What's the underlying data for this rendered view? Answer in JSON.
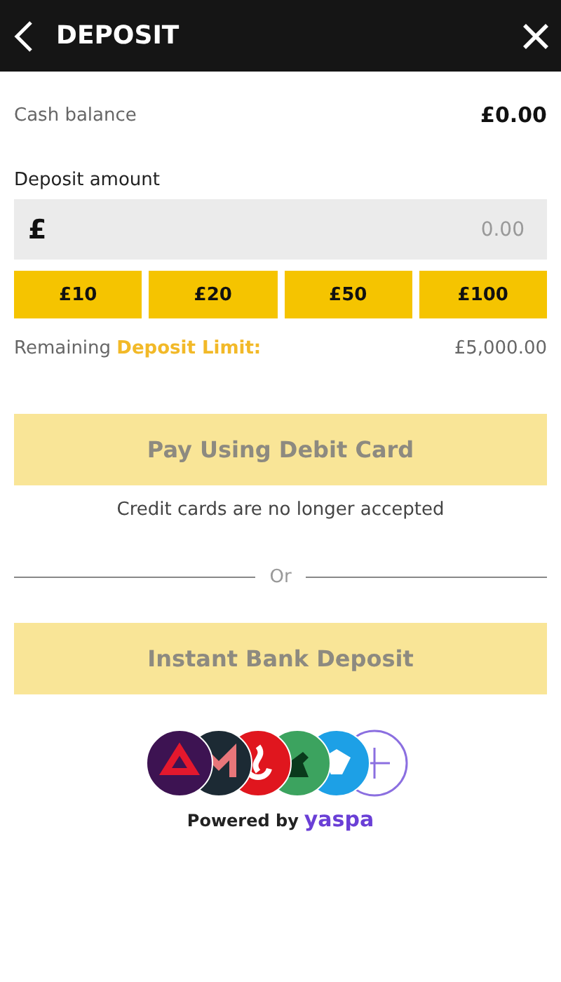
{
  "header": {
    "title": "DEPOSIT"
  },
  "cash_balance": {
    "label": "Cash balance",
    "value": "£0.00"
  },
  "deposit_amount": {
    "label": "Deposit amount",
    "currency": "£",
    "placeholder": "0.00"
  },
  "quick_amounts": [
    "£10",
    "£20",
    "£50",
    "£100"
  ],
  "limit": {
    "prefix": "Remaining",
    "highlight": "Deposit Limit:",
    "value": "£5,000.00"
  },
  "debit_card_button": {
    "label": "Pay Using Debit Card",
    "disabled": true
  },
  "note": "Credit cards are no longer accepted",
  "divider": "Or",
  "bank_button": {
    "label": "Instant Bank Deposit",
    "disabled": true
  },
  "powered_by": {
    "label": "Powered by",
    "brand": "yaspa"
  }
}
